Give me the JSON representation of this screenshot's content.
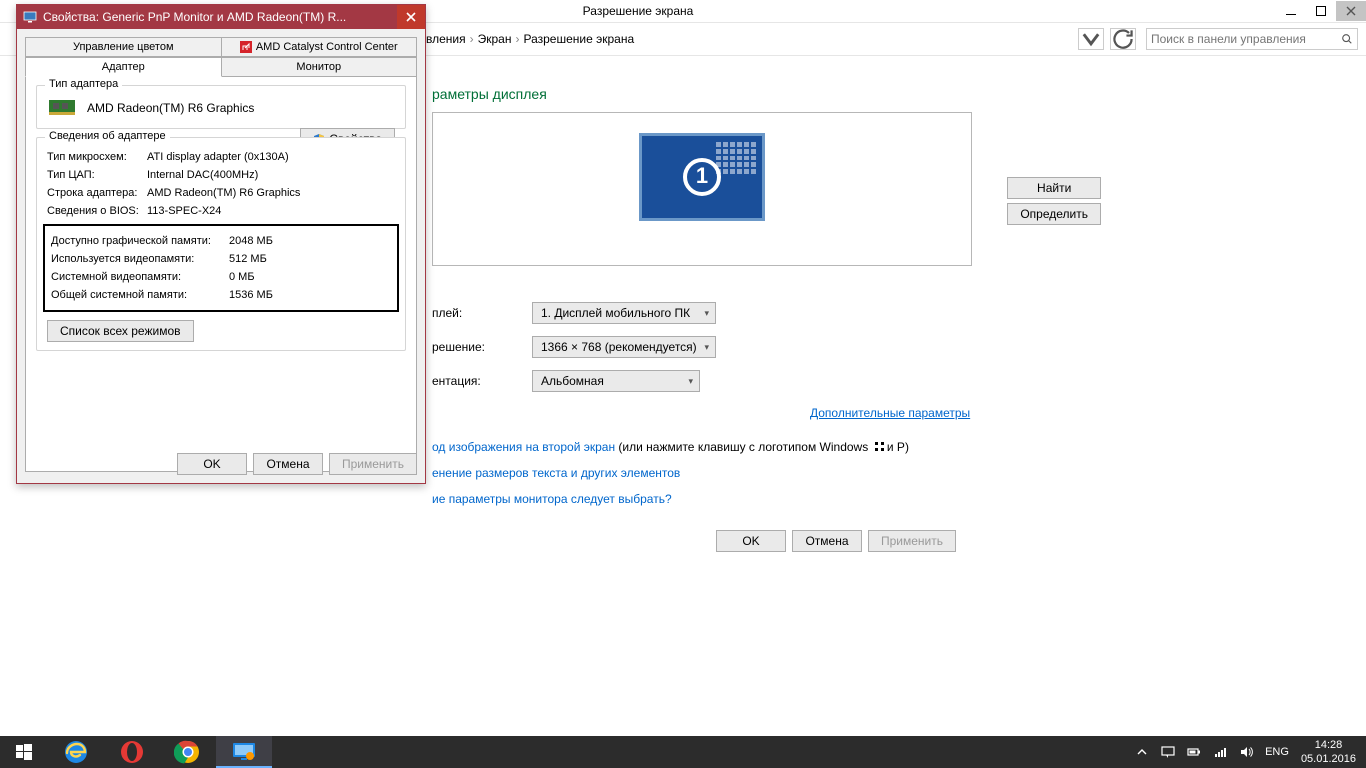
{
  "cp": {
    "title": "Разрешение экрана",
    "breadcrumb": {
      "item1": "вления",
      "item2": "Экран",
      "item3": "Разрешение экрана"
    },
    "search_placeholder": "Поиск в панели управления",
    "heading": "раметры дисплея",
    "buttons": {
      "find": "Найти",
      "detect": "Определить"
    },
    "rows": {
      "display_label": "плей:",
      "display_value": "1. Дисплей мобильного ПК",
      "resolution_label": "решение:",
      "resolution_value": "1366 × 768 (рекомендуется)",
      "orientation_label": "ентация:",
      "orientation_value": "Альбомная"
    },
    "advanced": "Дополнительные параметры",
    "linkrow1_link": "од изображения на второй экран",
    "linkrow1_rest": " (или нажмите клавишу с логотипом Windows ",
    "linkrow1_tail": " и P)",
    "linkrow2": "енение размеров текста и других элементов",
    "linkrow3": "ие параметры монитора следует выбрать?",
    "footer": {
      "ok": "OK",
      "cancel": "Отмена",
      "apply": "Применить"
    },
    "monitor_num": "1"
  },
  "dlg": {
    "title": "Свойства: Generic PnP Monitor и AMD Radeon(TM) R...",
    "tabs": {
      "color": "Управление цветом",
      "catalyst": "AMD Catalyst Control Center",
      "adapter": "Адаптер",
      "monitor": "Монитор"
    },
    "group_adapter": "Тип адаптера",
    "adapter_name": "AMD Radeon(TM) R6 Graphics",
    "prop_btn": "Свойства",
    "group_info": "Сведения об адаптере",
    "info": {
      "chip_l": "Тип микросхем:",
      "chip_v": "ATI display adapter (0x130A)",
      "dac_l": "Тип ЦАП:",
      "dac_v": "Internal DAC(400MHz)",
      "str_l": "Строка адаптера:",
      "str_v": "AMD Radeon(TM) R6 Graphics",
      "bios_l": "Сведения о BIOS:",
      "bios_v": "113-SPEC-X24"
    },
    "mem": {
      "avail_l": "Доступно графической памяти:",
      "avail_v": "2048 МБ",
      "used_l": "Используется видеопамяти:",
      "used_v": "512 МБ",
      "sys_l": "Системной видеопамяти:",
      "sys_v": "0 МБ",
      "shared_l": "Общей системной памяти:",
      "shared_v": "1536 МБ"
    },
    "modes_btn": "Список всех режимов",
    "footer": {
      "ok": "OK",
      "cancel": "Отмена",
      "apply": "Применить"
    }
  },
  "tray": {
    "lang": "ENG",
    "time": "14:28",
    "date": "05.01.2016"
  }
}
